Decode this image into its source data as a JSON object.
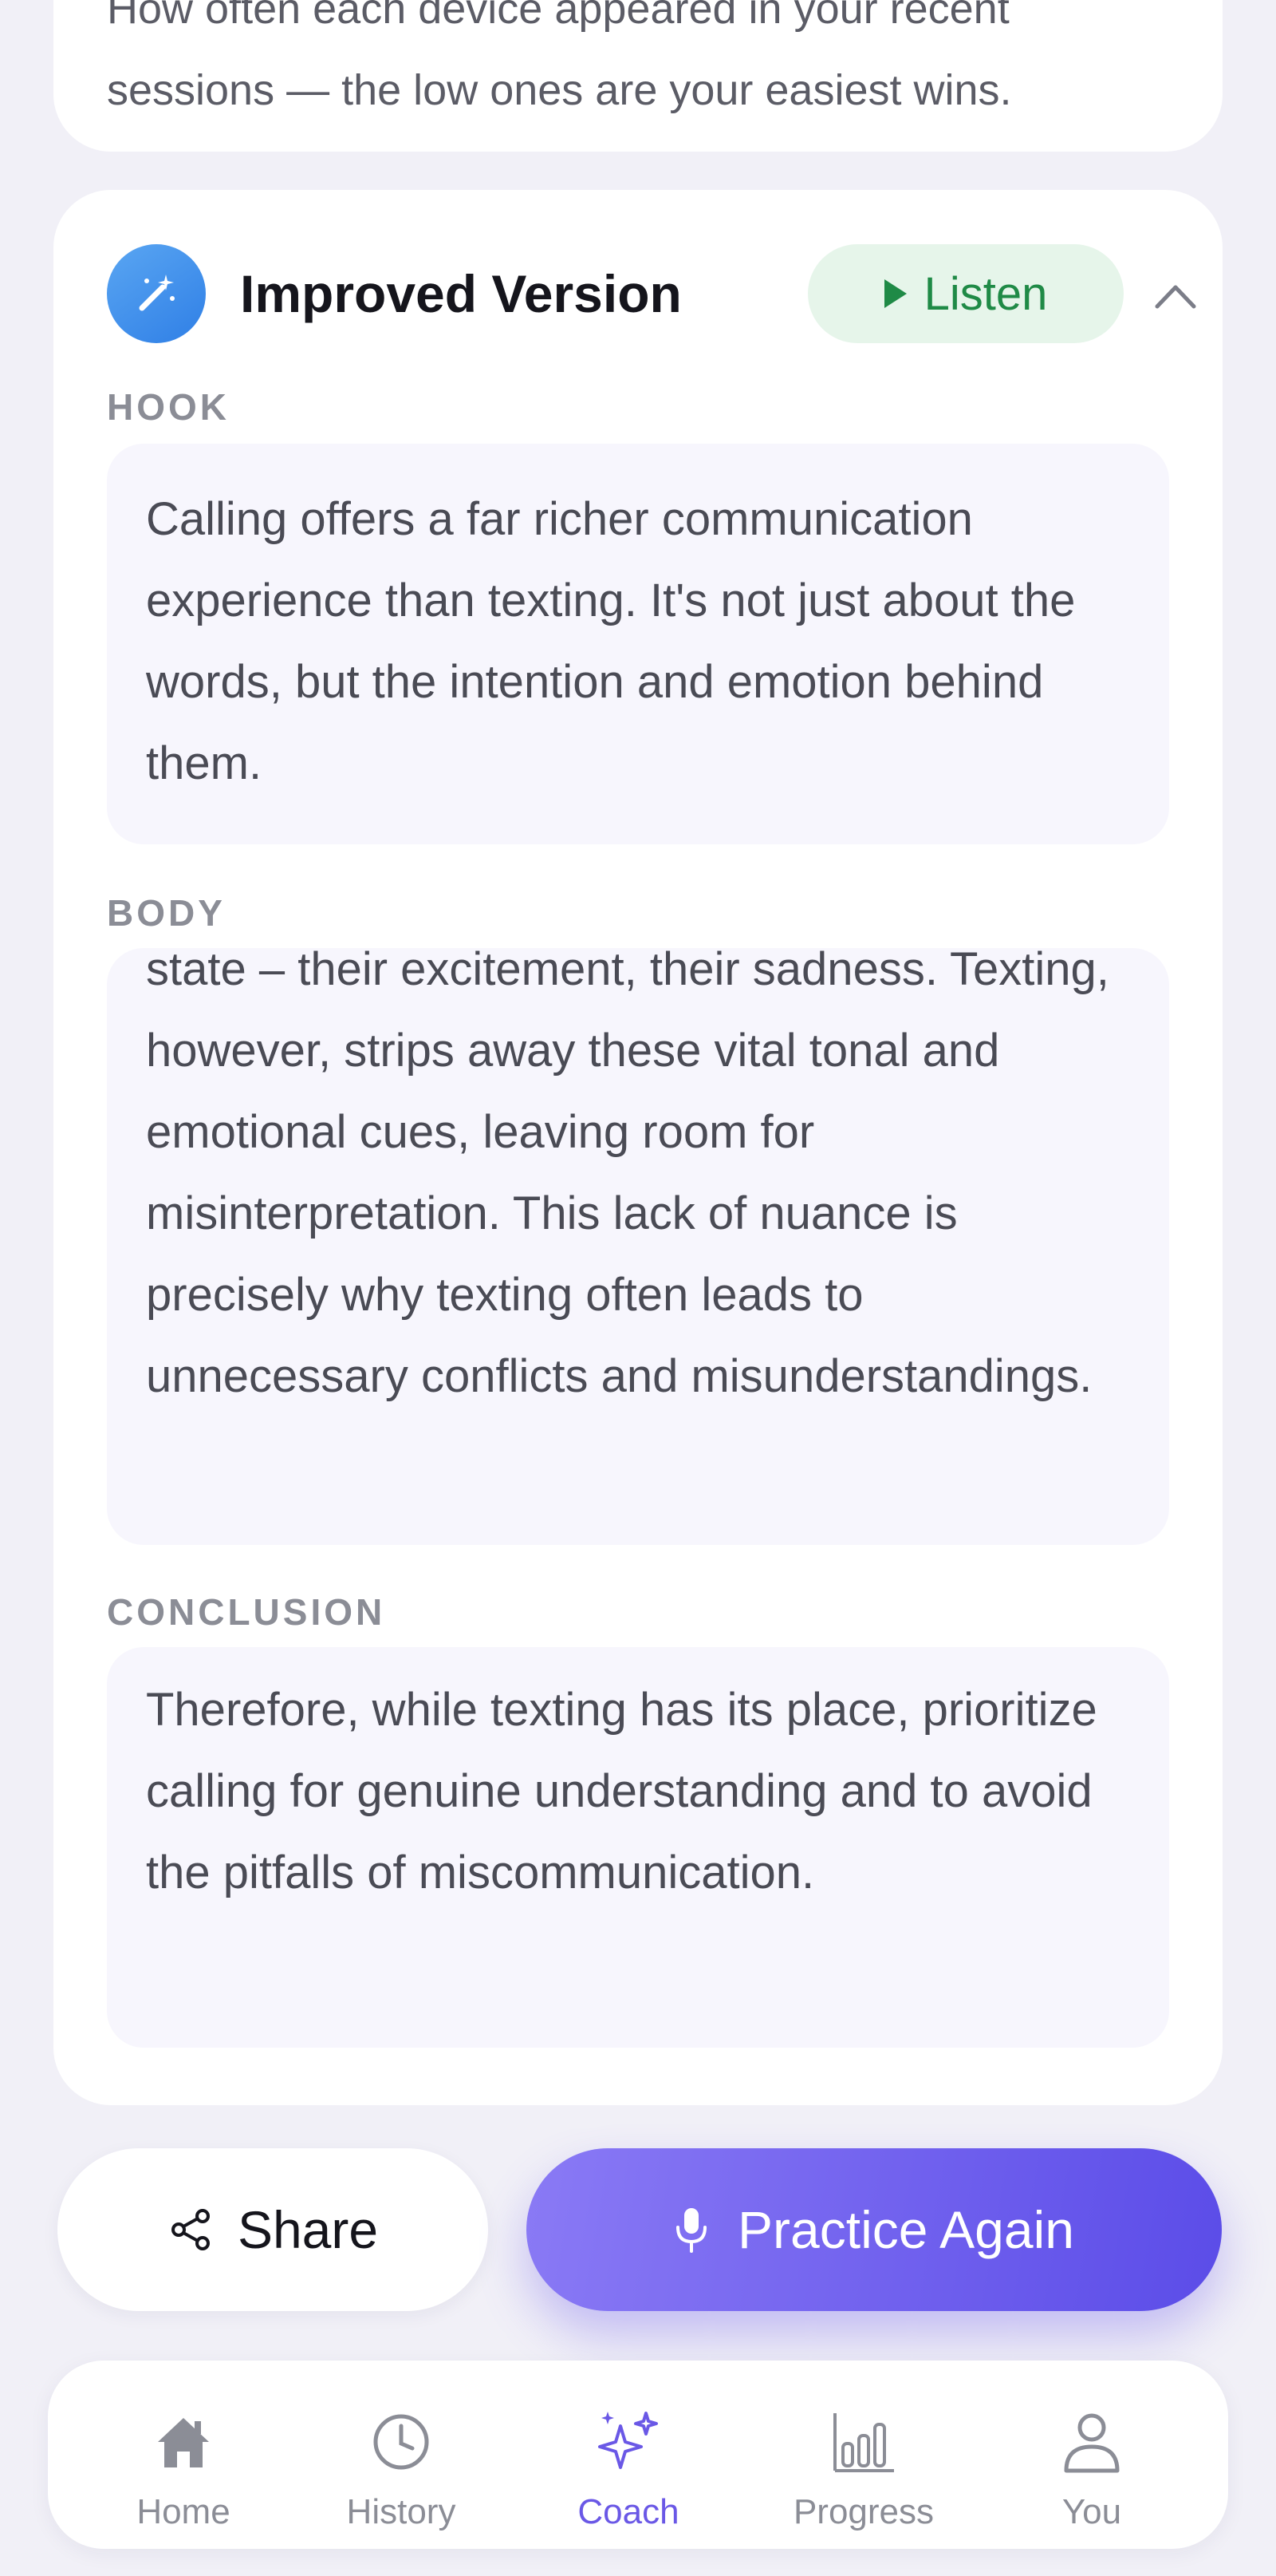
{
  "top_card": {
    "description": "How often each device appeared in your recent sessions — the low ones are your easiest wins."
  },
  "improved_version": {
    "title": "Improved Version",
    "listen_label": "Listen",
    "sections": [
      {
        "label": "HOOK",
        "text": "Calling offers a far richer communication experience than texting. It's not just about the words, but the intention and emotion behind them."
      },
      {
        "label": "BODY",
        "text": "state – their excitement, their sadness. Texting, however, strips away these vital tonal and emotional cues, leaving room for misinterpretation. This lack of nuance is precisely why texting often leads to unnecessary conflicts and misunderstandings."
      },
      {
        "label": "CONCLUSION",
        "text": "Therefore, while texting has its place, prioritize calling for genuine understanding and to avoid the pitfalls of miscommunication."
      }
    ]
  },
  "actions": {
    "share_label": "Share",
    "practice_label": "Practice Again"
  },
  "nav": {
    "items": [
      {
        "label": "Home",
        "icon": "home-icon"
      },
      {
        "label": "History",
        "icon": "clock-icon"
      },
      {
        "label": "Coach",
        "icon": "sparkles-icon",
        "active": true
      },
      {
        "label": "Progress",
        "icon": "bar-chart-icon"
      },
      {
        "label": "You",
        "icon": "person-icon"
      }
    ]
  },
  "colors": {
    "accent": "#6a58e6",
    "listen_green": "#1f8a46",
    "badge_blue": "#3b8ceb"
  }
}
